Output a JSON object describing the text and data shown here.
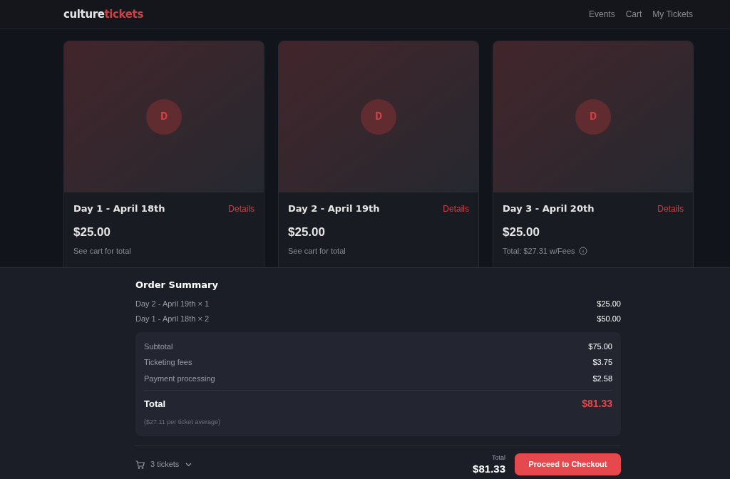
{
  "header": {
    "logo_parts": [
      "culture",
      "tickets"
    ],
    "nav": [
      "Events",
      "Cart",
      "My Tickets"
    ]
  },
  "events": [
    {
      "initial": "D",
      "title": "Day 1 - April 18th",
      "details": "Details",
      "price": "$25.00",
      "note": "See cart for total",
      "note_info": false
    },
    {
      "initial": "D",
      "title": "Day 2 - April 19th",
      "details": "Details",
      "price": "$25.00",
      "note": "See cart for total",
      "note_info": false
    },
    {
      "initial": "D",
      "title": "Day 3 - April 20th",
      "details": "Details",
      "price": "$25.00",
      "note": "Total: $27.31 w/Fees",
      "note_info": true
    }
  ],
  "order_summary": {
    "title": "Order Summary",
    "items": [
      {
        "label": "Day 2 - April 19th × 1",
        "amount": "$25.00"
      },
      {
        "label": "Day 1 - April 18th × 2",
        "amount": "$50.00"
      }
    ],
    "breakdown": [
      {
        "label": "Subtotal",
        "amount": "$75.00"
      },
      {
        "label": "Ticketing fees",
        "amount": "$3.75"
      },
      {
        "label": "Payment processing",
        "amount": "$2.58"
      }
    ],
    "total_label": "Total",
    "total": "$81.33",
    "average": "($27.11 per ticket average)"
  },
  "footer": {
    "tickets": "3 tickets",
    "total_label": "Total",
    "total": "$81.33",
    "checkout": "Proceed to Checkout"
  }
}
